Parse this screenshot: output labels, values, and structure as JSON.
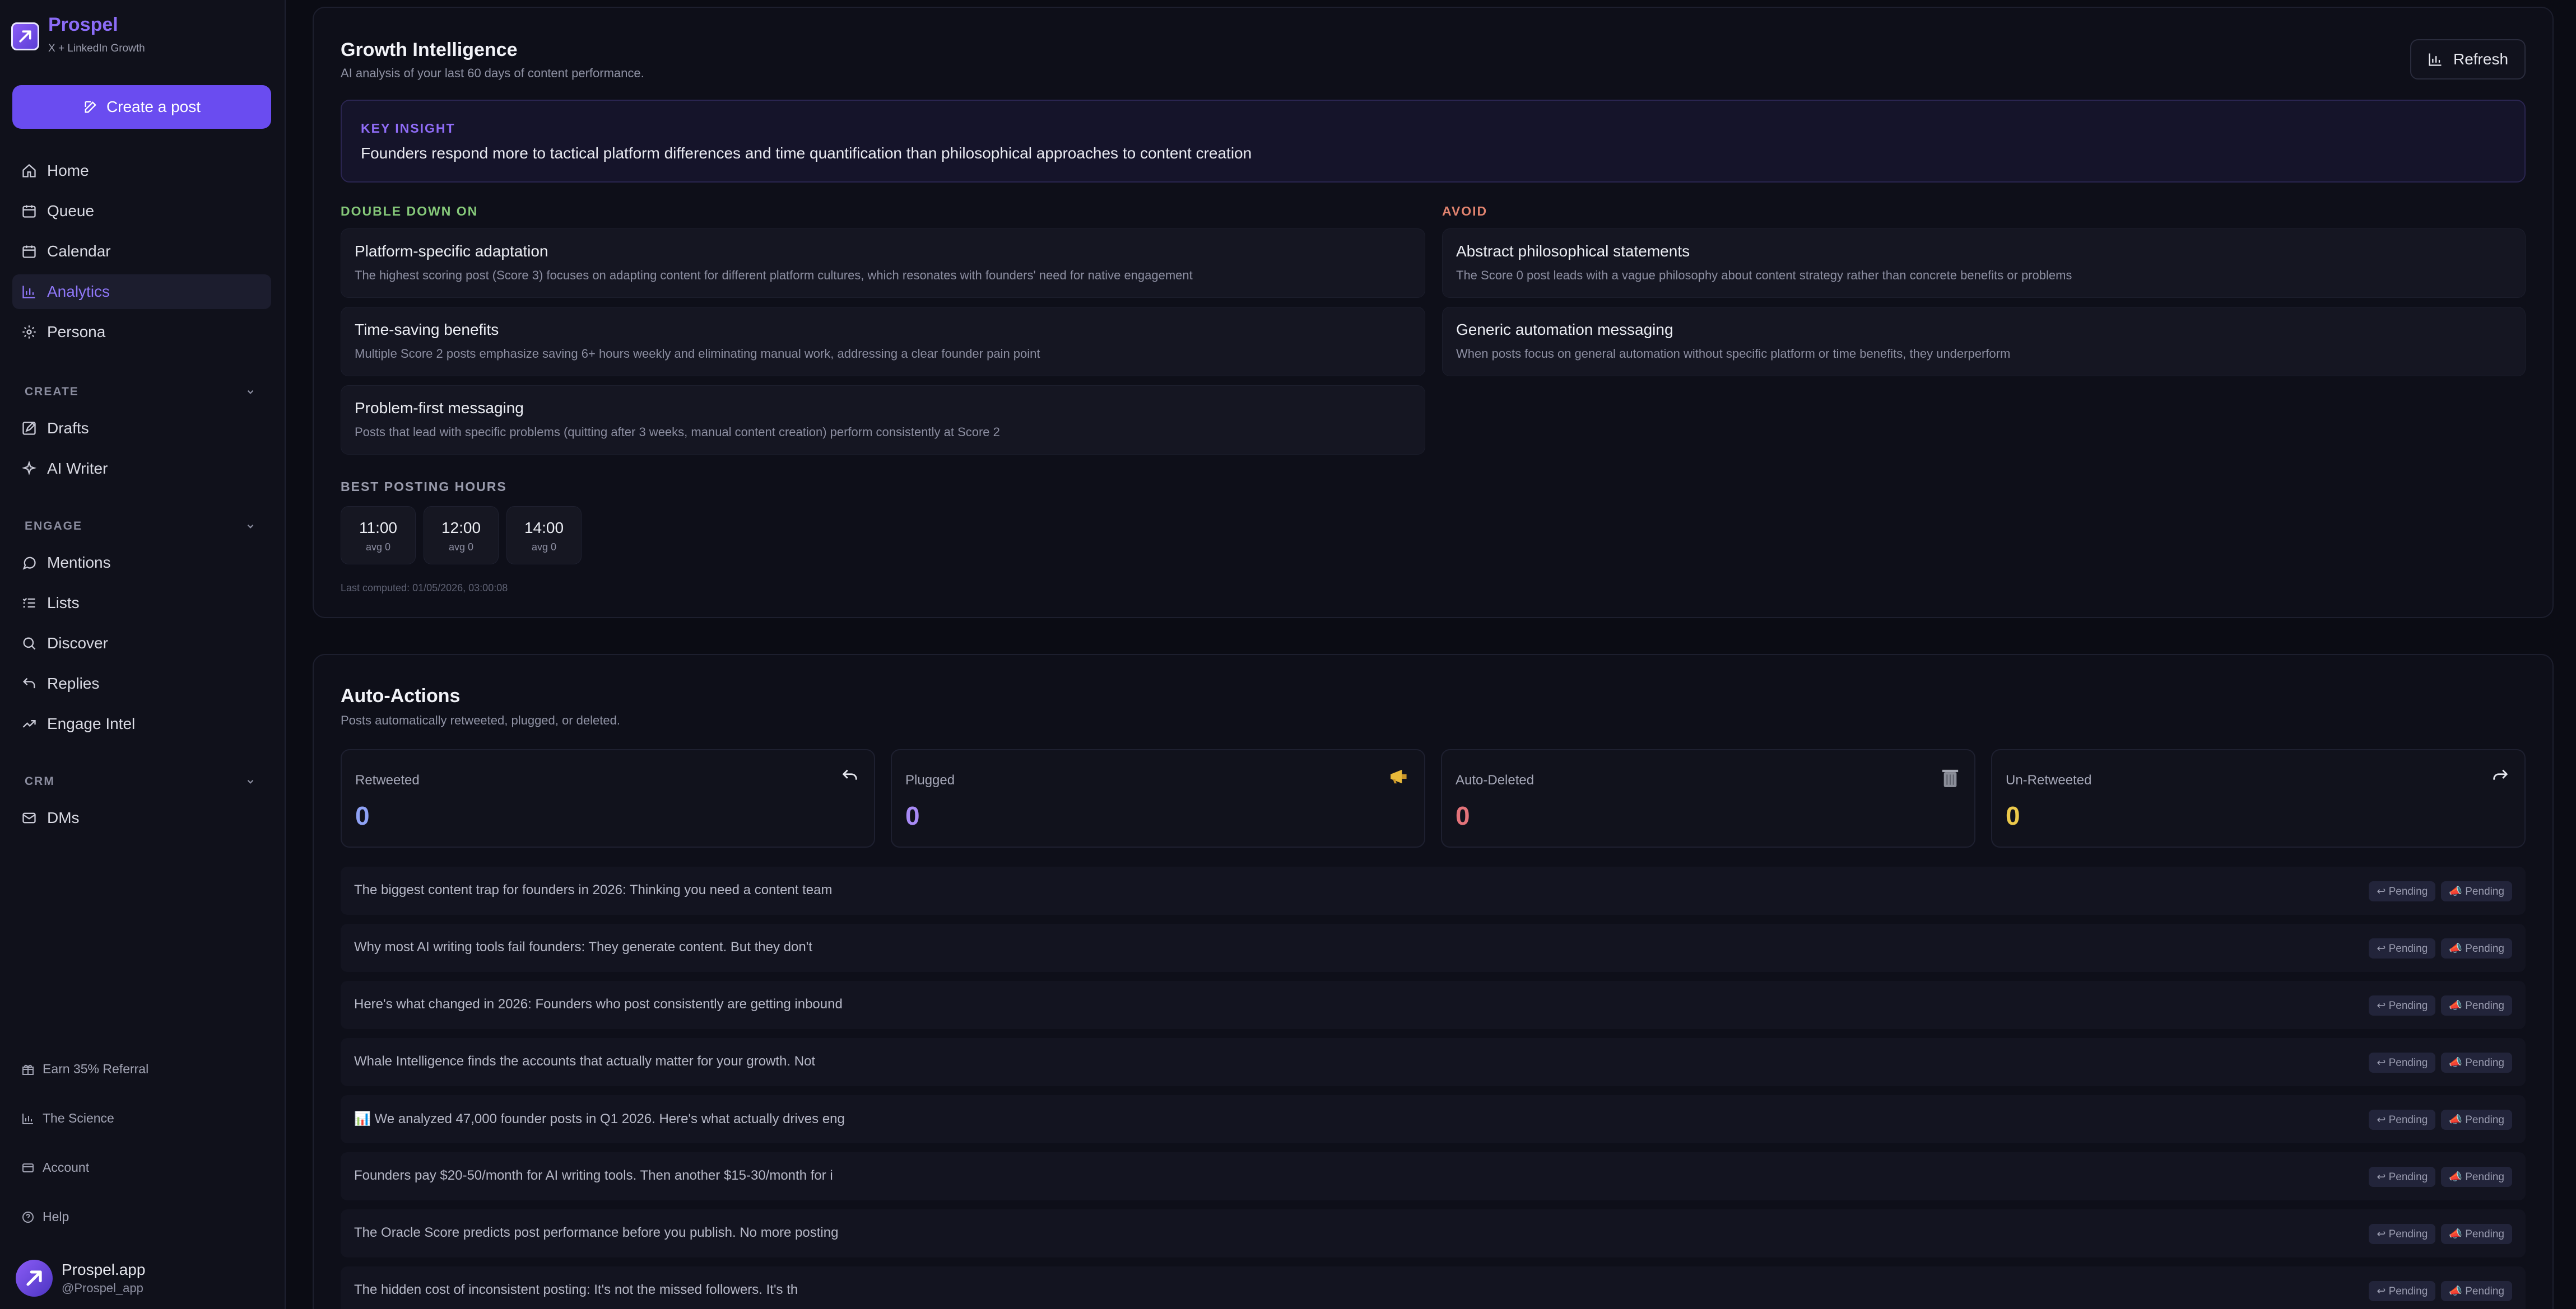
{
  "brand": {
    "name": "Prospel",
    "subtitle": "X + LinkedIn Growth"
  },
  "sidebar": {
    "create_button": "Create a post",
    "main_nav": [
      {
        "label": "Home",
        "icon": "home-icon"
      },
      {
        "label": "Queue",
        "icon": "calendar-icon"
      },
      {
        "label": "Calendar",
        "icon": "calendar-icon"
      },
      {
        "label": "Analytics",
        "icon": "bar-chart-icon",
        "active": true
      },
      {
        "label": "Persona",
        "icon": "gear-icon"
      }
    ],
    "sections": [
      {
        "title": "CREATE",
        "items": [
          {
            "label": "Drafts",
            "icon": "edit-icon"
          },
          {
            "label": "AI Writer",
            "icon": "sparkle-icon"
          }
        ]
      },
      {
        "title": "ENGAGE",
        "items": [
          {
            "label": "Mentions",
            "icon": "chat-bubble-icon"
          },
          {
            "label": "Lists",
            "icon": "list-icon"
          },
          {
            "label": "Discover",
            "icon": "search-icon"
          },
          {
            "label": "Replies",
            "icon": "reply-icon"
          },
          {
            "label": "Engage Intel",
            "icon": "trending-up-icon"
          }
        ]
      },
      {
        "title": "CRM",
        "items": [
          {
            "label": "DMs",
            "icon": "mail-icon"
          }
        ]
      }
    ],
    "footer": [
      {
        "label": "Earn 35% Referral",
        "icon": "gift-icon"
      },
      {
        "label": "The Science",
        "icon": "bar-chart-icon"
      },
      {
        "label": "Account",
        "icon": "credit-card-icon"
      },
      {
        "label": "Help",
        "icon": "help-circle-icon"
      }
    ],
    "user": {
      "name": "Prospel.app",
      "handle": "@Prospel_app"
    }
  },
  "growth": {
    "title": "Growth Intelligence",
    "subtitle": "AI analysis of your last 60 days of content performance.",
    "refresh_label": "Refresh",
    "insight_label": "KEY INSIGHT",
    "insight_text": "Founders respond more to tactical platform differences and time quantification than philosophical approaches to content creation",
    "double_down_label": "DOUBLE DOWN ON",
    "avoid_label": "AVOID",
    "double_down": [
      {
        "title": "Platform-specific adaptation",
        "desc": "The highest scoring post (Score 3) focuses on adapting content for different platform cultures, which resonates with founders' need for native engagement"
      },
      {
        "title": "Time-saving benefits",
        "desc": "Multiple Score 2 posts emphasize saving 6+ hours weekly and eliminating manual work, addressing a clear founder pain point"
      },
      {
        "title": "Problem-first messaging",
        "desc": "Posts that lead with specific problems (quitting after 3 weeks, manual content creation) perform consistently at Score 2"
      }
    ],
    "avoid": [
      {
        "title": "Abstract philosophical statements",
        "desc": "The Score 0 post leads with a vague philosophy about content strategy rather than concrete benefits or problems"
      },
      {
        "title": "Generic automation messaging",
        "desc": "When posts focus on general automation without specific platform or time benefits, they underperform"
      }
    ],
    "best_hours_label": "BEST POSTING HOURS",
    "best_hours": [
      {
        "time": "11:00",
        "avg": "avg 0"
      },
      {
        "time": "12:00",
        "avg": "avg 0"
      },
      {
        "time": "14:00",
        "avg": "avg 0"
      }
    ],
    "last_computed": "Last computed: 01/05/2026, 03:00:08"
  },
  "auto_actions": {
    "title": "Auto-Actions",
    "subtitle": "Posts automatically retweeted, plugged, or deleted.",
    "stats": [
      {
        "label": "Retweeted",
        "value": "0",
        "color": "#8fa2f5",
        "icon": "retweet-icon"
      },
      {
        "label": "Plugged",
        "value": "0",
        "color": "#a88af5",
        "icon": "megaphone-icon"
      },
      {
        "label": "Auto-Deleted",
        "value": "0",
        "color": "#e3737a",
        "icon": "trash-icon"
      },
      {
        "label": "Un-Retweeted",
        "value": "0",
        "color": "#ecc94b",
        "icon": "undo-retweet-icon"
      }
    ],
    "posts": [
      {
        "text": "The biggest content trap for founders in 2026: Thinking you need a content team",
        "badge1": "↩ Pending",
        "badge2": "📣 Pending"
      },
      {
        "text": "Why most AI writing tools fail founders: They generate content. But they don't",
        "badge1": "↩ Pending",
        "badge2": "📣 Pending"
      },
      {
        "text": "Here's what changed in 2026: Founders who post consistently are getting inbound",
        "badge1": "↩ Pending",
        "badge2": "📣 Pending"
      },
      {
        "text": "Whale Intelligence finds the accounts that actually matter for your growth. Not",
        "badge1": "↩ Pending",
        "badge2": "📣 Pending"
      },
      {
        "text": "📊 We analyzed 47,000 founder posts in Q1 2026. Here's what actually drives eng",
        "badge1": "↩ Pending",
        "badge2": "📣 Pending"
      },
      {
        "text": "Founders pay $20-50/month for AI writing tools. Then another $15-30/month for i",
        "badge1": "↩ Pending",
        "badge2": "📣 Pending"
      },
      {
        "text": "The Oracle Score predicts post performance before you publish. No more posting",
        "badge1": "↩ Pending",
        "badge2": "📣 Pending"
      },
      {
        "text": "The hidden cost of inconsistent posting: It's not the missed followers. It's th",
        "badge1": "↩ Pending",
        "badge2": "📣 Pending"
      }
    ]
  }
}
